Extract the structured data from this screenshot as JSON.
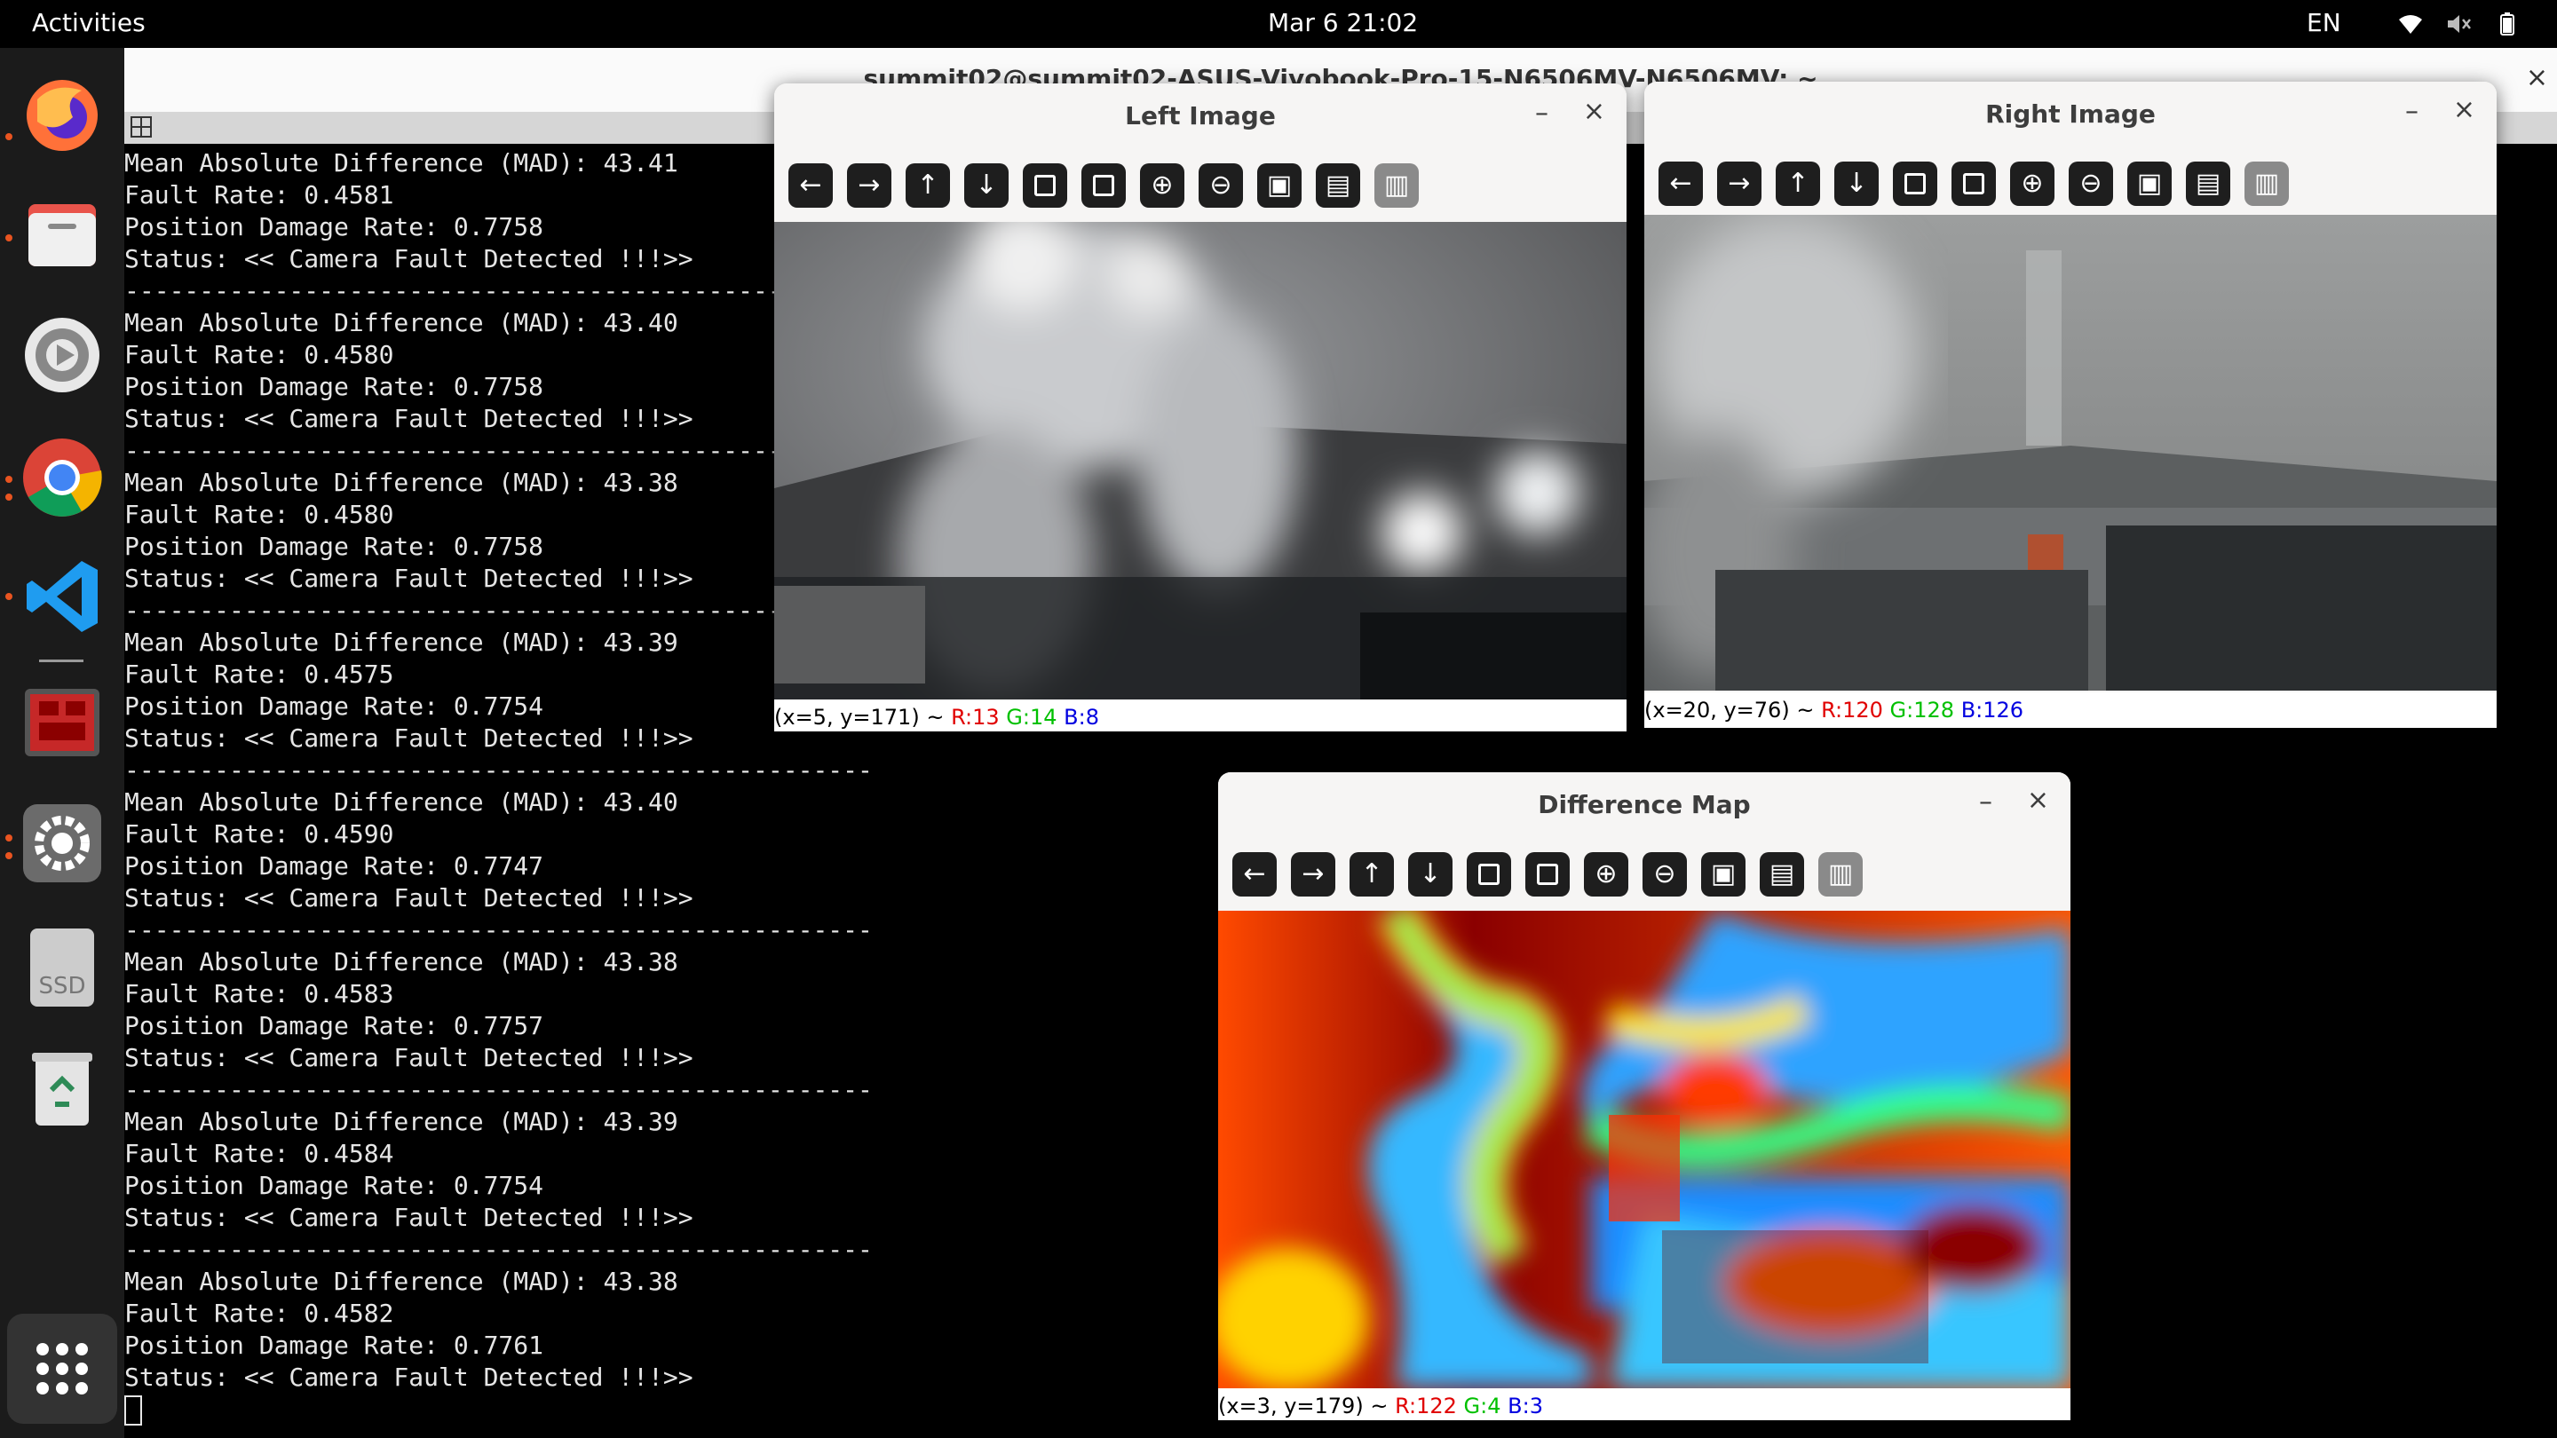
{
  "topbar": {
    "activities": "Activities",
    "clock": "Mar 6  21:02",
    "lang": "EN",
    "tray_icons": [
      "wifi-icon",
      "volume-muted-icon",
      "battery-icon"
    ]
  },
  "dock": {
    "items": [
      "firefox",
      "files",
      "rhythmbox-settings",
      "chrome",
      "vscode",
      "app-monitor",
      "settings",
      "ssd-drive",
      "trash"
    ],
    "ssd_label": "SSD",
    "show_apps_icon": "grid-icon"
  },
  "terminal": {
    "title": "summit02@summit02-ASUS-Vivobook-Pro-15-N6506MV-N6506MV: ~",
    "separator": "--------------------------------------------------",
    "blocks": [
      {
        "mad": "Mean Absolute Difference (MAD): 43.41",
        "fault": "Fault Rate: 0.4581",
        "pos": "Position Damage Rate: 0.7758",
        "status": "Status: << Camera Fault Detected !!!>>"
      },
      {
        "mad": "Mean Absolute Difference (MAD): 43.40",
        "fault": "Fault Rate: 0.4580",
        "pos": "Position Damage Rate: 0.7758",
        "status": "Status: << Camera Fault Detected !!!>>"
      },
      {
        "mad": "Mean Absolute Difference (MAD): 43.38",
        "fault": "Fault Rate: 0.4580",
        "pos": "Position Damage Rate: 0.7758",
        "status": "Status: << Camera Fault Detected !!!>>"
      },
      {
        "mad": "Mean Absolute Difference (MAD): 43.39",
        "fault": "Fault Rate: 0.4575",
        "pos": "Position Damage Rate: 0.7754",
        "status": "Status: << Camera Fault Detected !!!>>"
      },
      {
        "mad": "Mean Absolute Difference (MAD): 43.40",
        "fault": "Fault Rate: 0.4590",
        "pos": "Position Damage Rate: 0.7747",
        "status": "Status: << Camera Fault Detected !!!>>"
      },
      {
        "mad": "Mean Absolute Difference (MAD): 43.38",
        "fault": "Fault Rate: 0.4583",
        "pos": "Position Damage Rate: 0.7757",
        "status": "Status: << Camera Fault Detected !!!>>"
      },
      {
        "mad": "Mean Absolute Difference (MAD): 43.39",
        "fault": "Fault Rate: 0.4584",
        "pos": "Position Damage Rate: 0.7754",
        "status": "Status: << Camera Fault Detected !!!>>"
      },
      {
        "mad": "Mean Absolute Difference (MAD): 43.38",
        "fault": "Fault Rate: 0.4582",
        "pos": "Position Damage Rate: 0.7761",
        "status": "Status: << Camera Fault Detected !!!>>"
      }
    ]
  },
  "left_window": {
    "title": "Left Image",
    "status_pos": "(x=5, y=171) ~ ",
    "r": "R:13",
    "g": "G:14",
    "b": "B:8"
  },
  "right_window": {
    "title": "Right Image",
    "status_pos": "(x=20, y=76) ~ ",
    "r": "R:120",
    "g": "G:128",
    "b": "B:126"
  },
  "diff_window": {
    "title": "Difference Map",
    "status_pos": "(x=3, y=179) ~ ",
    "r": "R:122",
    "g": "G:4",
    "b": "B:3"
  },
  "window_controls": {
    "minimize": "–",
    "close": "×"
  },
  "toolbar_icons": [
    "arrow-left-icon",
    "arrow-right-icon",
    "arrow-up-icon",
    "arrow-down-icon",
    "zoom-fit-icon",
    "zoom-image-icon",
    "zoom-in-icon",
    "zoom-out-icon",
    "save-icon",
    "copy-clipboard-icon",
    "properties-icon"
  ],
  "toolbar_glyphs": [
    "←",
    "→",
    "↑",
    "↓",
    "",
    "",
    "⊕",
    "⊖",
    "▣",
    "▤",
    "▥"
  ]
}
